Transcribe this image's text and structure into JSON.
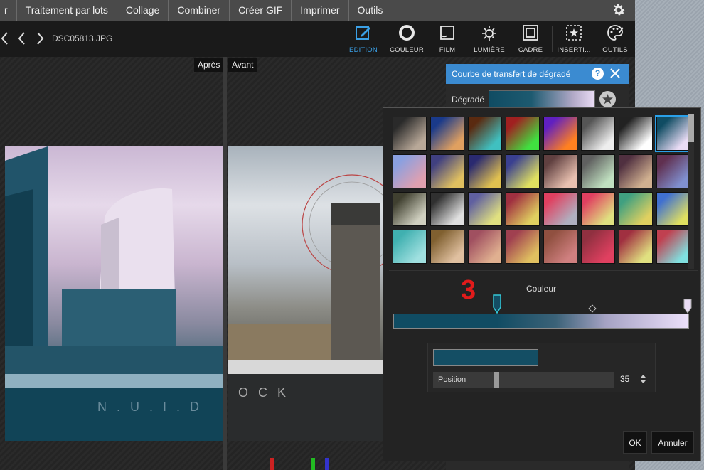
{
  "menu": {
    "items": [
      "r",
      "Traitement par lots",
      "Collage",
      "Combiner",
      "Créer GIF",
      "Imprimer",
      "Outils"
    ]
  },
  "toolbar": {
    "filename": "DSC05813.JPG",
    "tools": [
      {
        "label": "EDITION",
        "icon": "edit-icon",
        "active": true
      },
      {
        "label": "COULEUR",
        "icon": "color-ring-icon"
      },
      {
        "label": "FILM",
        "icon": "film-icon"
      },
      {
        "label": "LUMIÈRE",
        "icon": "sun-icon"
      },
      {
        "label": "CADRE",
        "icon": "frame-icon"
      },
      {
        "label": "INSERTI...",
        "icon": "insert-star-icon"
      },
      {
        "label": "OUTILS",
        "icon": "palette-icon"
      }
    ]
  },
  "compare": {
    "after": "Après",
    "before": "Avant"
  },
  "dialog": {
    "title": "Courbe de transfert de dégradé",
    "gradient_label": "Dégradé"
  },
  "editor": {
    "annotation": "3",
    "color_label": "Couleur",
    "position_label": "Position",
    "position_value": "35",
    "swatch_color": "#144e64",
    "ok": "OK",
    "cancel": "Annuler"
  },
  "presets": [
    [
      "#2a2a2a,#b8a898",
      "#1a3a8a,#e0a060",
      "#5a2a10,#40c0c0",
      "#a02020,#40e040",
      "#6020c0,#ff8020",
      "#555,#eee",
      "#222,#fff",
      "#104c63,#eadcf5"
    ],
    [
      "#8aa0e0,#e0a0b0",
      "#404080,#e0c060",
      "#2a2a70,#e0c050",
      "#3a4090,#e0e060",
      "#604040,#e8c0b0",
      "#606060,#c0e0c0",
      "#503040,#d0b090",
      "#603050,#8090d0"
    ],
    [
      "#404030,#d0d0c0",
      "#303030,#e0e0e0",
      "#6060a0,#e0e080",
      "#a03040,#e0d060",
      "#e04060,#b0b0c0",
      "#e04060,#e0e080",
      "#40a080,#e0d060",
      "#4070d0,#e0e060"
    ],
    [
      "#40b0b0,#a0e0e0",
      "#806030,#e0c0a0",
      "#a05060,#e0b090",
      "#a04050,#e0c060",
      "#905040,#d08080",
      "#903040,#e04060",
      "#a03040,#e0e080",
      "#c04050,#80e0e0"
    ]
  ]
}
